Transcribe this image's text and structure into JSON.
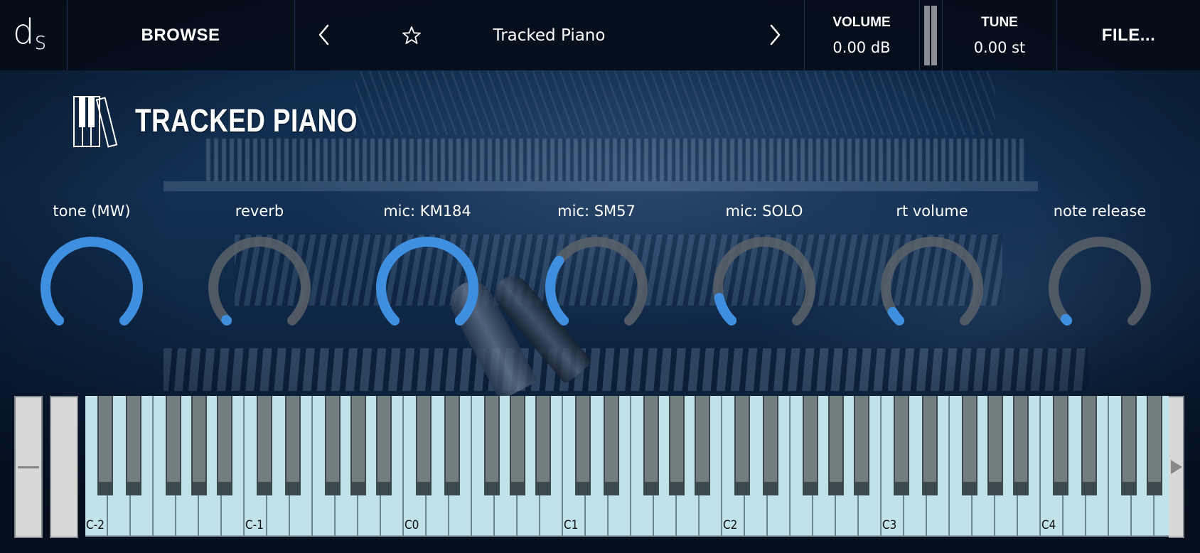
{
  "header": {
    "logo": {
      "d": "d",
      "s": "S"
    },
    "browse_label": "BROWSE",
    "prev_icon": "chevron-left-icon",
    "favorite_icon": "star-icon",
    "preset_name": "Tracked Piano",
    "next_icon": "chevron-right-icon",
    "volume": {
      "label": "VOLUME",
      "value": "0.00 dB"
    },
    "tune": {
      "label": "TUNE",
      "value": "0.00 st"
    },
    "file_label": "FILE..."
  },
  "instrument": {
    "title": "TRACKED PIANO",
    "icon": "piano-keys-icon"
  },
  "colors": {
    "accent": "#3f8fe0",
    "knob_track": "#5b6169",
    "white_key": "#c2e2ea",
    "black_key": "#727d7d"
  },
  "knobs": [
    {
      "label": "tone (MW)",
      "value": 1.0
    },
    {
      "label": "reverb",
      "value": 0.0
    },
    {
      "label": "mic: KM184",
      "value": 1.0
    },
    {
      "label": "mic: SM57",
      "value": 0.3
    },
    {
      "label": "mic: SOLO",
      "value": 0.12
    },
    {
      "label": "rt volume",
      "value": 0.05
    },
    {
      "label": "note release",
      "value": 0.01
    }
  ],
  "keyboard": {
    "octave_labels": [
      "C-2",
      "C-1",
      "C0",
      "C1",
      "C2",
      "C3",
      "C4"
    ],
    "pitch_wheel": "pitch-wheel",
    "mod_wheel": "mod-wheel",
    "scroll_icon": "triangle-right-icon"
  }
}
